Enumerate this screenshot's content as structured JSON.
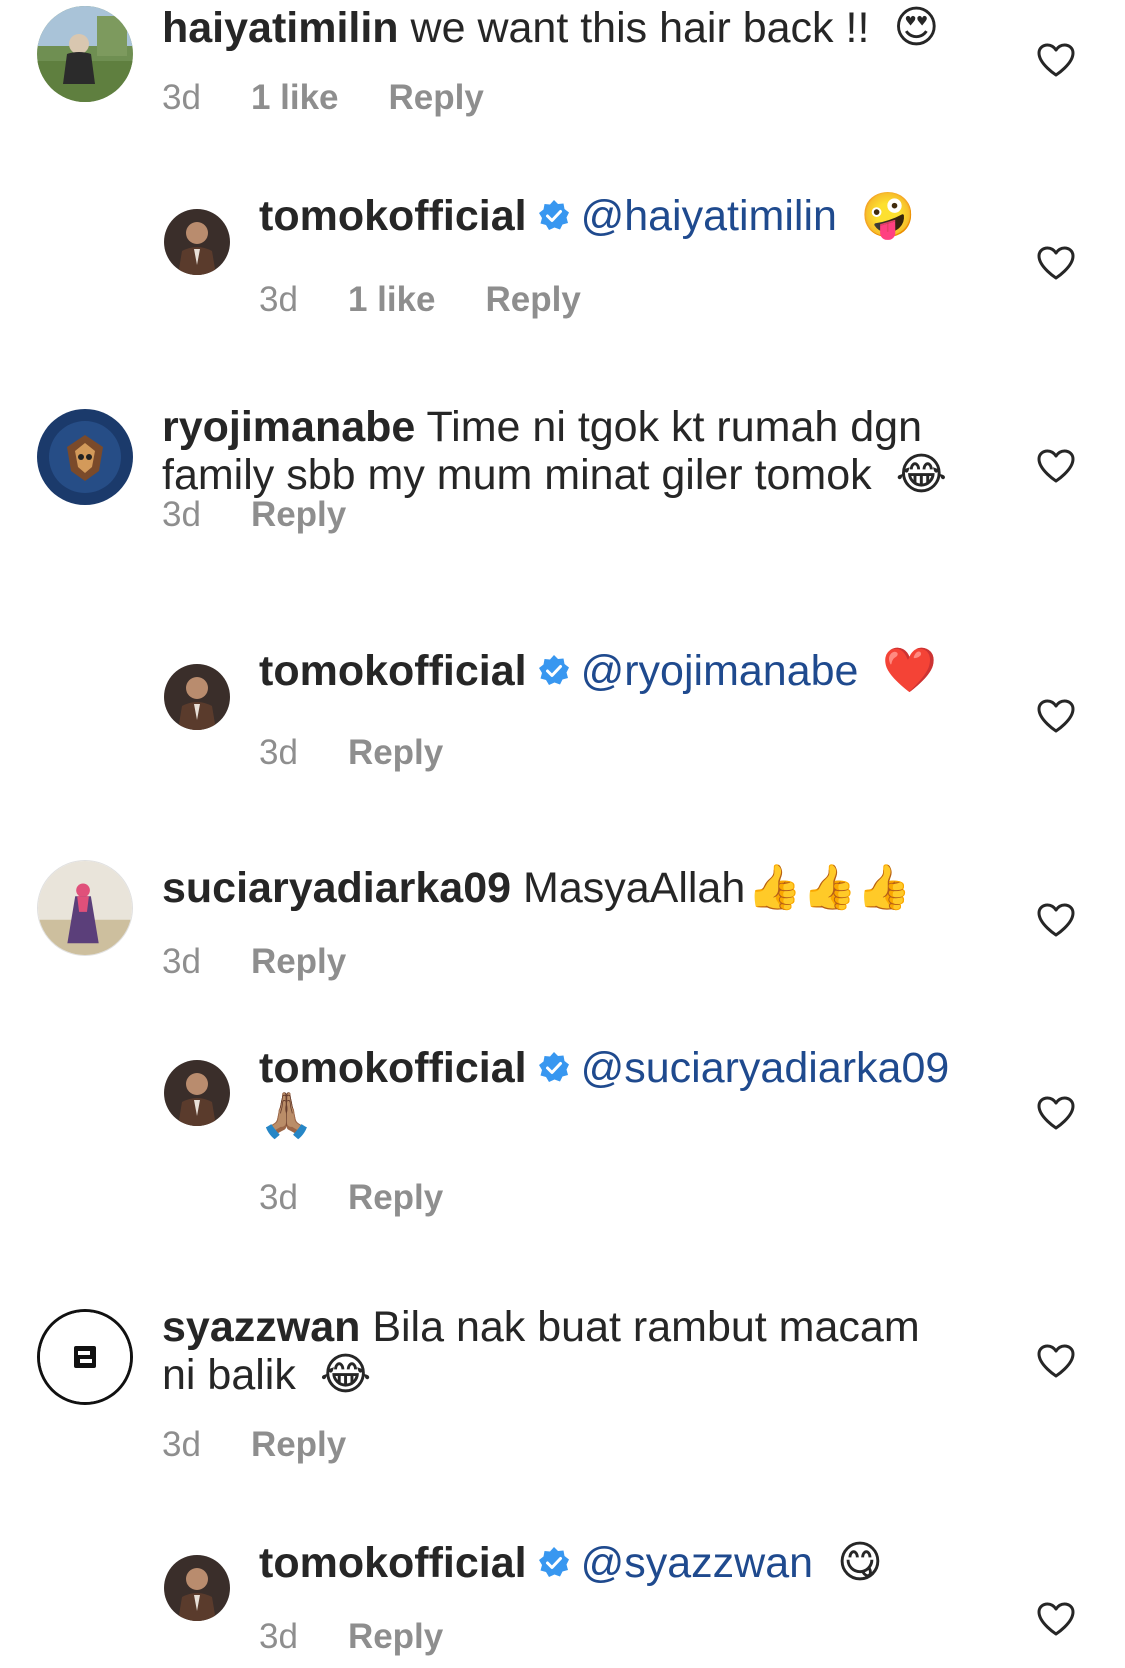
{
  "comments": [
    {
      "username": "haiyatimilin",
      "text": "we want this hair back !!",
      "emoji": "😍",
      "time": "3d",
      "likes": "1 like",
      "reply_label": "Reply",
      "avatar_icon": "park-photo-avatar"
    },
    {
      "username": "tomokofficial",
      "verified": true,
      "mention": "@haiyatimilin",
      "emoji": "🤪",
      "time": "3d",
      "likes": "1 like",
      "reply_label": "Reply",
      "avatar_icon": "man-in-suit-avatar"
    },
    {
      "username": "ryojimanabe",
      "text_line1": "Time ni tgok kt rumah dgn",
      "text_line2": "family sbb my mum minat giler tomok",
      "emoji": "😂",
      "time": "3d",
      "reply_label": "Reply",
      "avatar_icon": "game-emblem-avatar"
    },
    {
      "username": "tomokofficial",
      "verified": true,
      "mention": "@ryojimanabe",
      "emoji": "❤️",
      "time": "3d",
      "reply_label": "Reply",
      "avatar_icon": "man-in-suit-avatar"
    },
    {
      "username": "suciaryadiarka09",
      "text": "MasyaAllah",
      "emoji": "👍👍👍",
      "time": "3d",
      "reply_label": "Reply",
      "avatar_icon": "woman-in-field-avatar"
    },
    {
      "username": "tomokofficial",
      "verified": true,
      "mention": "@suciaryadiarka09",
      "emoji": "🙏🏽",
      "time": "3d",
      "reply_label": "Reply",
      "avatar_icon": "man-in-suit-avatar"
    },
    {
      "username": "syazzwan",
      "text_line1": "Bila nak buat rambut macam",
      "text_line2": "ni balik",
      "emoji": "😂",
      "time": "3d",
      "reply_label": "Reply",
      "avatar_icon": "s-logo-avatar"
    },
    {
      "username": "tomokofficial",
      "verified": true,
      "mention": "@syazzwan",
      "emoji": "😋",
      "time": "3d",
      "reply_label": "Reply",
      "avatar_icon": "man-in-suit-avatar"
    }
  ],
  "colors": {
    "username": "#262626",
    "meta": "#8e8e8e",
    "mention": "#1f4a8e",
    "verified": "#3897f0"
  }
}
